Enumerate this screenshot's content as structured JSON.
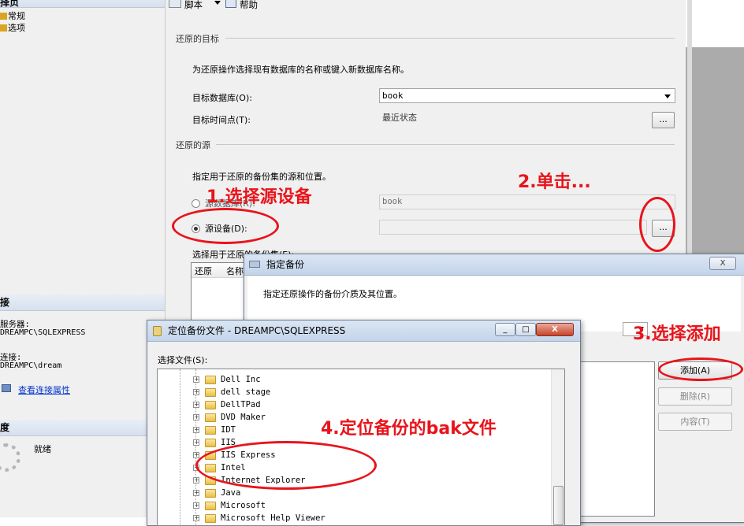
{
  "left_pane": {
    "select_page_header": "择页",
    "pages": [
      "常规",
      "选项"
    ],
    "connection_header": "接",
    "server_label": "服务器:",
    "server_value": "DREAMPC\\SQLEXPRESS",
    "connection_label": "连接:",
    "connection_value": "DREAMPC\\dream",
    "view_connection_link": "查看连接属性",
    "progress_header": "度",
    "progress_status": "就绪"
  },
  "toolbar": {
    "script_label": "脚本",
    "help_label": "帮助"
  },
  "restore_target": {
    "group_title": "还原的目标",
    "description": "为还原操作选择现有数据库的名称或键入新数据库名称。",
    "target_db_label": "目标数据库(O):",
    "target_db_value": "book",
    "target_time_label": "目标时间点(T):",
    "target_time_value": "最近状态",
    "browse_label": "..."
  },
  "restore_source": {
    "group_title": "还原的源",
    "description": "指定用于还原的备份集的源和位置。",
    "source_db_label": "源数据库(R):",
    "source_db_value": "book",
    "source_device_label": "源设备(D):",
    "source_device_value": "",
    "browse_label": "...",
    "backup_sets_label": "选择用于还原的备份集(E):",
    "columns": [
      "还原",
      "名称"
    ]
  },
  "specify_backup_dialog": {
    "title": "指定备份",
    "description": "指定还原操作的备份介质及其位置。",
    "add_button": "添加(A)",
    "remove_button": "删除(R)",
    "contents_button": "内容(T)",
    "close_label": "X"
  },
  "locate_file_dialog": {
    "title": "定位备份文件 - DREAMPC\\SQLEXPRESS",
    "select_file_label": "选择文件(S):",
    "folders": [
      "Dell Inc",
      "dell stage",
      "DellTPad",
      "DVD Maker",
      "IDT",
      "IIS",
      "IIS Express",
      "Intel",
      "Internet Explorer",
      "Java",
      "Microsoft",
      "Microsoft Help Viewer"
    ],
    "minimize_label": "_",
    "maximize_label": "□",
    "close_label": "X"
  },
  "annotations": {
    "step1": "1.选择源设备",
    "step2": "2.单击...",
    "step3": "3.选择添加",
    "step4": "4.定位备份的bak文件"
  },
  "colors": {
    "annotation_red": "#e8141b",
    "link_blue": "#0033cc",
    "title_bar": "#c3d4ea"
  }
}
